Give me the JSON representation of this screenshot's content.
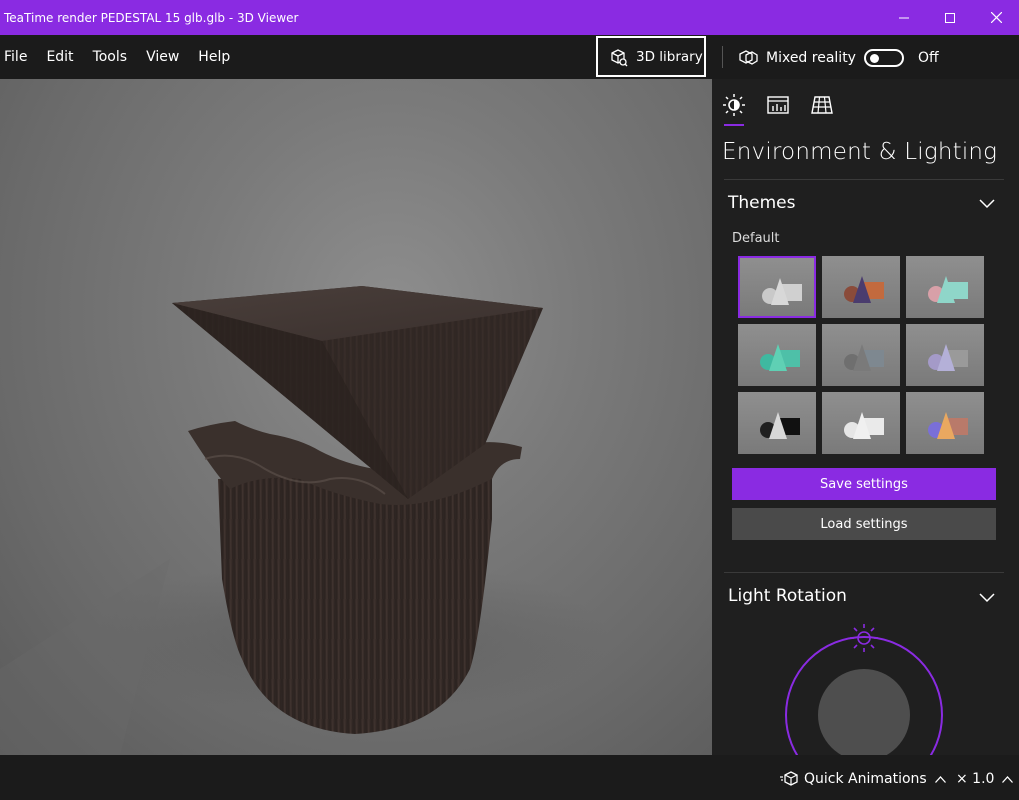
{
  "window": {
    "title": "TeaTime render PEDESTAL 15 glb.glb - 3D Viewer",
    "controls": [
      "minimize-icon",
      "maximize-icon",
      "close-icon"
    ]
  },
  "menu": {
    "items": [
      "File",
      "Edit",
      "Tools",
      "View",
      "Help"
    ]
  },
  "toolbar": {
    "library_label": "3D library",
    "mixed_reality_label": "Mixed reality",
    "mixed_reality_state": "Off"
  },
  "panel": {
    "tabs": [
      "sun-icon",
      "stats-icon",
      "grid-icon"
    ],
    "title": "Environment & Lighting",
    "themes_header": "Themes",
    "themes_sublabel": "Default",
    "themes": [
      {
        "shapes": [
          "sphere",
          "cone",
          "box"
        ],
        "colors": [
          "#c9c9c9",
          "#d8d8d8",
          "#d0d0d0"
        ],
        "selected": true
      },
      {
        "shapes": [
          "sphere",
          "cone",
          "box"
        ],
        "colors": [
          "#8a4b3a",
          "#4a3c6e",
          "#c26a3e"
        ],
        "selected": false
      },
      {
        "shapes": [
          "sphere",
          "cone",
          "box"
        ],
        "colors": [
          "#d8a0a8",
          "#8fd6c9",
          "#8fd6c9"
        ],
        "selected": false
      },
      {
        "shapes": [
          "sphere",
          "cone",
          "box"
        ],
        "colors": [
          "#3fb9a0",
          "#5fd0b4",
          "#4ec0a8"
        ],
        "selected": false
      },
      {
        "shapes": [
          "sphere",
          "cone",
          "box"
        ],
        "colors": [
          "#6f6f6f",
          "#7a7a7a",
          "#7e8890"
        ],
        "selected": false
      },
      {
        "shapes": [
          "sphere",
          "cone",
          "box"
        ],
        "colors": [
          "#a49ac8",
          "#b4b0d8",
          "#9a9a9a"
        ],
        "selected": false
      },
      {
        "shapes": [
          "sphere",
          "cone",
          "box"
        ],
        "colors": [
          "#202020",
          "#d8d8d8",
          "#111111"
        ],
        "selected": false
      },
      {
        "shapes": [
          "sphere",
          "cone",
          "box"
        ],
        "colors": [
          "#e6e6e6",
          "#f0f0f0",
          "#eaeaea"
        ],
        "selected": false
      },
      {
        "shapes": [
          "sphere",
          "cone",
          "box"
        ],
        "colors": [
          "#7a6fd8",
          "#e9a860",
          "#b97a6a"
        ],
        "selected": false
      }
    ],
    "save_label": "Save settings",
    "load_label": "Load settings",
    "light_rotation_header": "Light Rotation"
  },
  "statusbar": {
    "quick_animations_label": "Quick Animations",
    "speed": "× 1.0"
  },
  "colors": {
    "accent": "#8a2be2",
    "background": "#1f1f1f",
    "button_secondary": "#4a4a4a"
  }
}
